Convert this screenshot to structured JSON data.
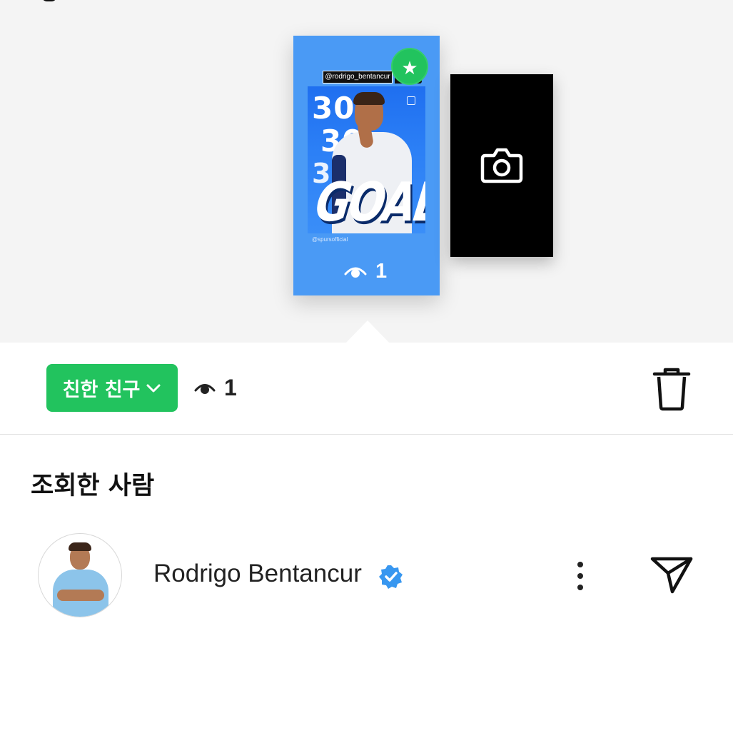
{
  "story_preview": {
    "mention_tag": "@rodrigo_bentancur",
    "image_numbers": [
      "30",
      "30",
      "3"
    ],
    "image_headline": "GOAL!",
    "image_credit": "@spursofficial",
    "view_count": "1"
  },
  "actions": {
    "audience_label": "친한 친구",
    "view_count": "1"
  },
  "viewers": {
    "heading": "조회한 사람",
    "list": [
      {
        "name": "Rodrigo Bentancur",
        "verified": true
      }
    ]
  },
  "colors": {
    "close_friends_green": "#22c35e",
    "story_background": "#4a9af5",
    "verified_blue": "#3897f0"
  },
  "icons": [
    "star-icon",
    "eye-icon",
    "camera-icon",
    "chevron-down-icon",
    "trash-icon",
    "verified-badge-icon",
    "more-options-icon",
    "send-icon"
  ]
}
